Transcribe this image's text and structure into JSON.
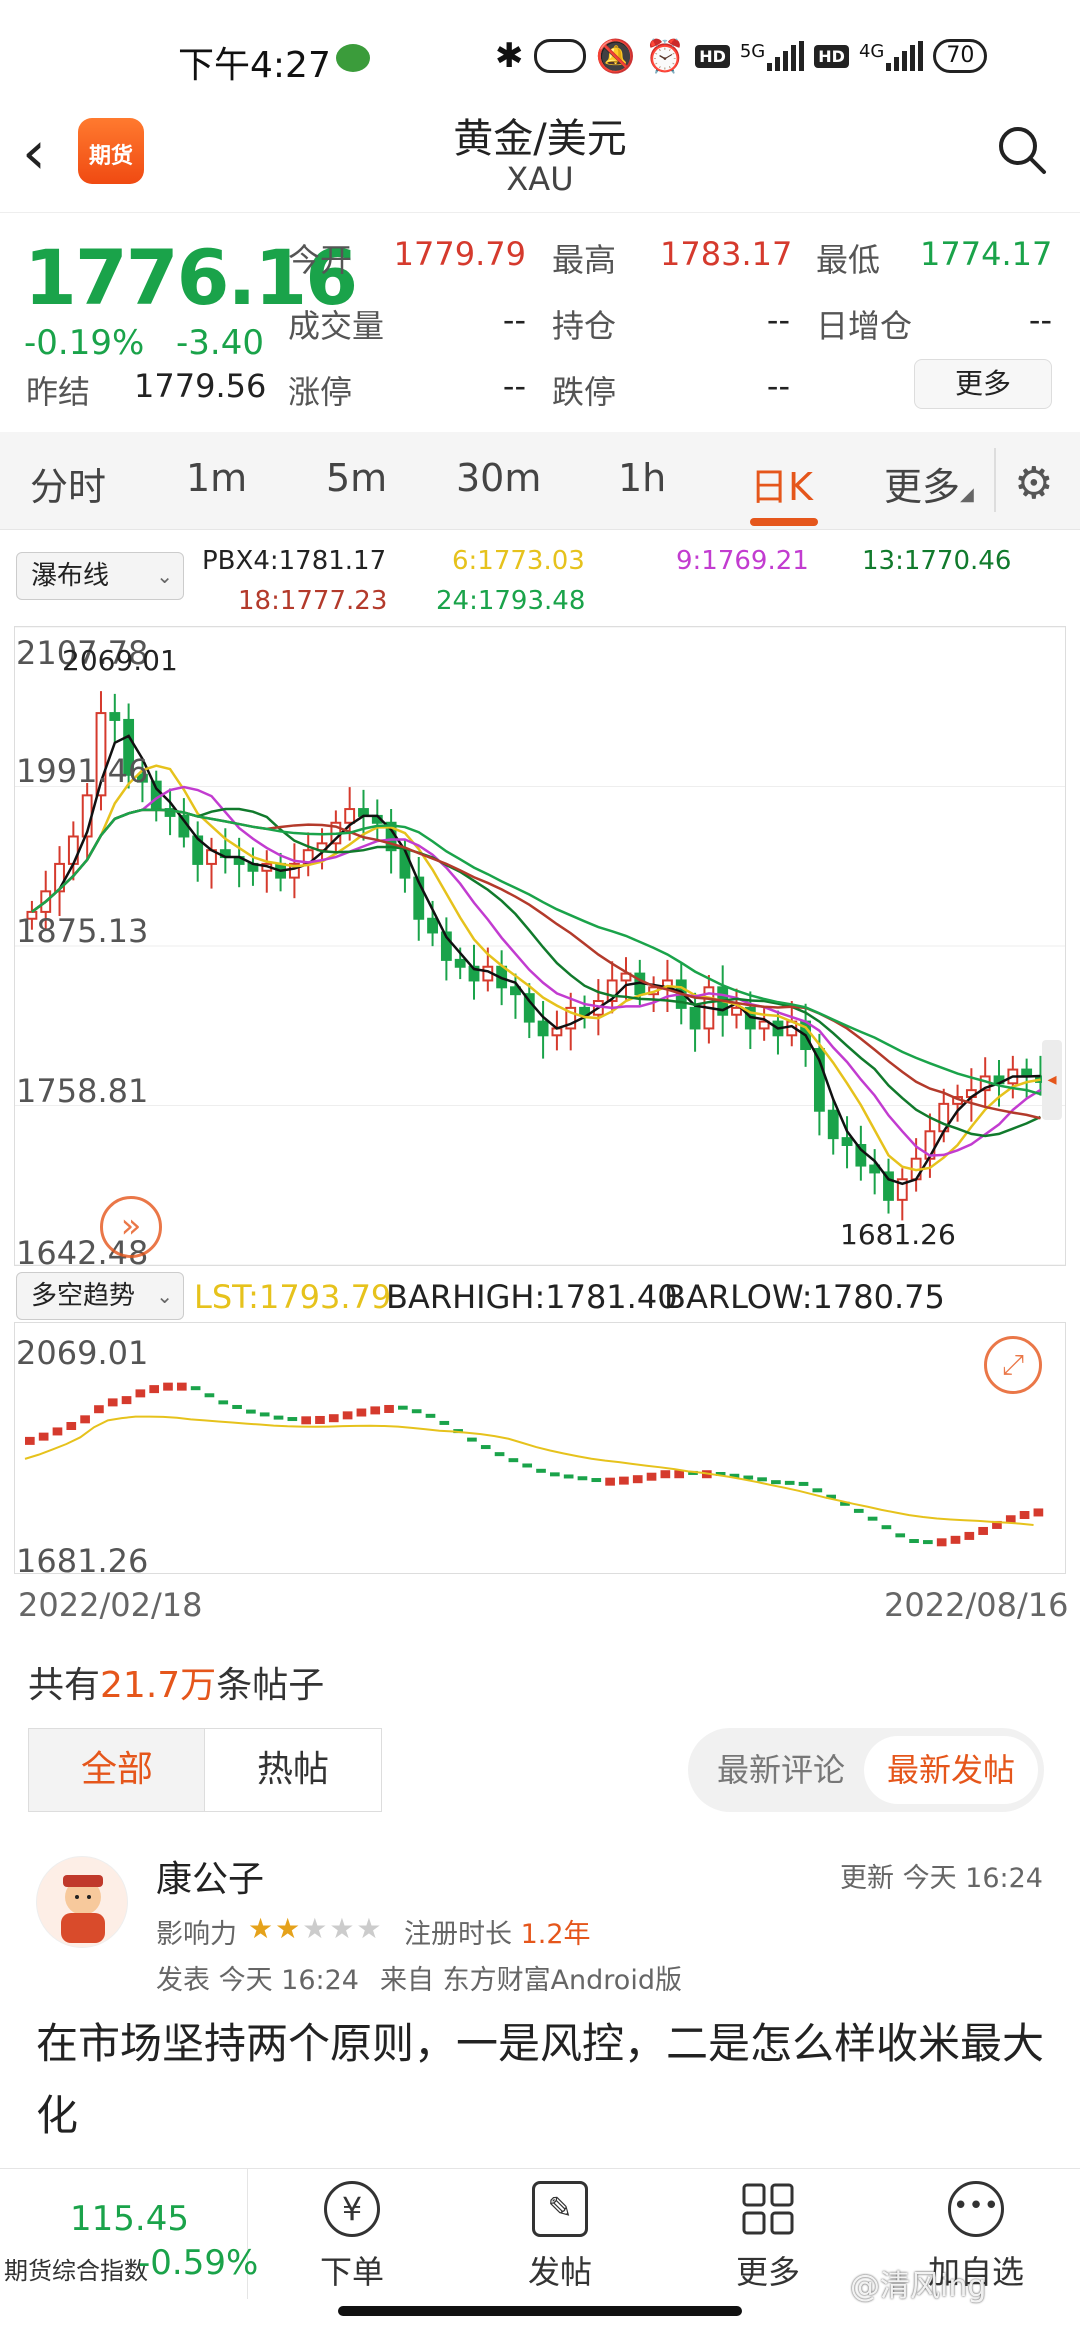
{
  "status_bar": {
    "time": "下午4:27",
    "battery": "70",
    "net1": "5G",
    "net2": "4G",
    "hd": "HD"
  },
  "header": {
    "title": "黄金/美元",
    "subtitle": "XAU",
    "logo_text": "期货"
  },
  "quote": {
    "price": "1776.16",
    "change_pct": "-0.19%",
    "change": "-3.40",
    "prev_close_label": "昨结",
    "prev_close": "1779.56",
    "open_label": "今开",
    "open": "1779.79",
    "high_label": "最高",
    "high": "1783.17",
    "low_label": "最低",
    "low": "1774.17",
    "volume_label": "成交量",
    "volume": "--",
    "oi_label": "持仓",
    "oi": "--",
    "daily_inc_label": "日增仓",
    "daily_inc": "--",
    "limit_up_label": "涨停",
    "limit_up": "--",
    "limit_down_label": "跌停",
    "limit_down": "--",
    "more_label": "更多"
  },
  "tabs": {
    "t0": "分时",
    "t1": "1m",
    "t2": "5m",
    "t3": "30m",
    "t4": "1h",
    "t5": "日K",
    "t6": "更多"
  },
  "indicator1": {
    "selector": "瀑布线",
    "pbx4": "PBX4:1781.17",
    "ma6": "6:1773.03",
    "ma9": "9:1769.21",
    "ma13": "13:1770.46",
    "ma18": "18:1777.23",
    "ma24": "24:1793.48"
  },
  "indicator2": {
    "selector": "多空趋势",
    "lst": "LST:1793.79",
    "barhigh": "BARHIGH:1781.40",
    "barlow": "BARLOW:1780.75"
  },
  "colors": {
    "up": "#d53a2d",
    "down": "#1aa34a",
    "accent": "#e5561b",
    "yellow": "#e6c21c",
    "magenta": "#c23cd0",
    "darkgreen": "#117a2c",
    "black": "#111111"
  },
  "chart_data": [
    {
      "type": "candlestick",
      "title": "",
      "y_axis_labels": [
        "2107.78",
        "1991.46",
        "1875.13",
        "1758.81",
        "1642.48"
      ],
      "ylim": [
        1642.48,
        2107.78
      ],
      "annotations": {
        "max": "2069.01",
        "min": "1681.26"
      },
      "x_range": [
        "2022/02/18",
        "2022/08/16"
      ],
      "grid": true,
      "close_series": [
        1900,
        1915,
        1935,
        1955,
        1985,
        2045,
        2040,
        2000,
        1995,
        1975,
        1970,
        1955,
        1935,
        1945,
        1940,
        1935,
        1930,
        1935,
        1925,
        1935,
        1945,
        1950,
        1965,
        1975,
        1970,
        1965,
        1945,
        1925,
        1895,
        1885,
        1865,
        1860,
        1850,
        1860,
        1845,
        1840,
        1820,
        1810,
        1815,
        1830,
        1825,
        1835,
        1850,
        1855,
        1840,
        1845,
        1850,
        1830,
        1815,
        1845,
        1825,
        1830,
        1815,
        1820,
        1810,
        1820,
        1800,
        1755,
        1735,
        1730,
        1715,
        1710,
        1690,
        1705,
        1720,
        1740,
        1760,
        1765,
        1770,
        1780,
        1775,
        1785,
        1780,
        1776
      ]
    },
    {
      "type": "line",
      "title": "",
      "y_axis_labels": [
        "2069.01",
        "1681.26"
      ],
      "ylim": [
        1681.26,
        2069.01
      ],
      "x_range": [
        "2022/02/18",
        "2022/08/16"
      ],
      "series_note": "trend dots + LST line"
    }
  ],
  "posts": {
    "count_prefix": "共有",
    "count": "21.7万",
    "count_suffix": "条帖子",
    "tab_all": "全部",
    "tab_hot": "热帖",
    "sort_comment": "最新评论",
    "sort_post": "最新发帖",
    "item": {
      "author": "康公子",
      "updated": "更新 今天 16:24",
      "influence_label": "影响力",
      "stars": "★★☆☆☆",
      "reg_label": "注册时长",
      "reg": "1.2年",
      "posted": "发表 今天 16:24",
      "source": "来自 东方财富Android版",
      "text": "在市场坚持两个原则，一是风控，二是怎么样收米最大化"
    }
  },
  "bottom_nav": {
    "index_value": "115.45",
    "index_name": "期货综合指数",
    "index_change": "-0.59%",
    "order": "下单",
    "post": "发帖",
    "more": "更多",
    "watch": "加自选",
    "watermark": "@清风ing"
  }
}
